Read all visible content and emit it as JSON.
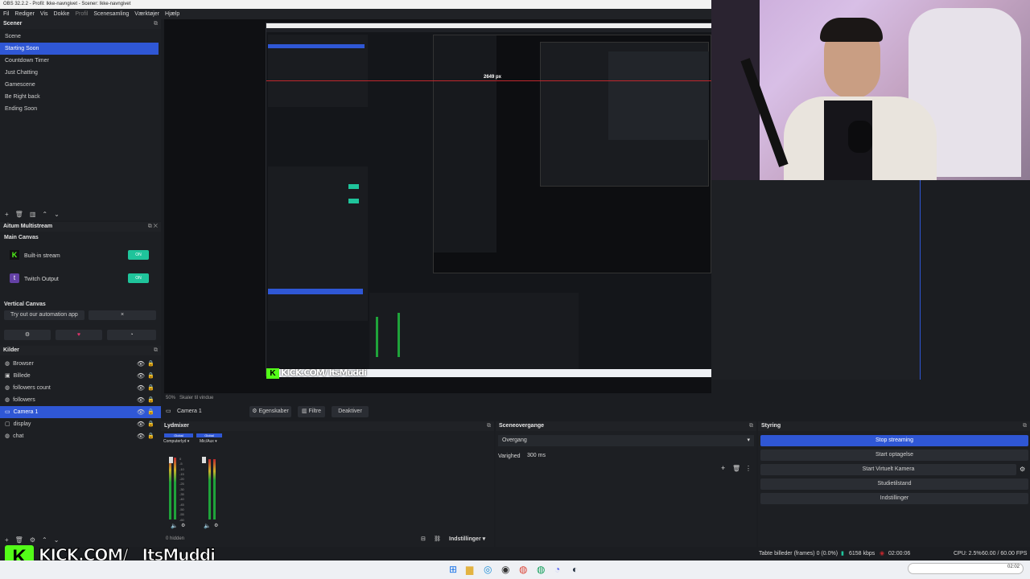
{
  "window": {
    "title": "OBS 32.2.2 - Profil: Ikke-navngivet - Scener: Ikke-navngivet"
  },
  "menu": [
    "Fil",
    "Rediger",
    "Vis",
    "Dokke",
    "Profil",
    "Scenesamling",
    "Værktøjer",
    "Hjælp"
  ],
  "scenes": {
    "header": "Scener",
    "items": [
      "Scene",
      "Starting Soon",
      "Countdown Timer",
      "Just Chatting",
      "Gamescene",
      "Be Right back",
      "Ending Soon"
    ],
    "selected": "Starting Soon"
  },
  "multistream": {
    "header": "Aitum Multistream",
    "main_canvas": "Main Canvas",
    "outputs": [
      {
        "label": "Built-in stream",
        "icon": "kick-icon"
      },
      {
        "label": "Twitch Output",
        "icon": "twitch-icon"
      }
    ],
    "vertical_canvas": "Vertical Canvas",
    "automation": "Try out our automation app",
    "close": "×"
  },
  "sources": {
    "header": "Kilder",
    "items": [
      "Browser",
      "Billede",
      "followers count",
      "followers",
      "Camera 1",
      "display",
      "chat"
    ],
    "selected": "Camera 1",
    "hidden_count": "0 hidden"
  },
  "source_bar": {
    "name": "Camera 1",
    "properties": "Egenskaber",
    "filters": "Filtre",
    "deactivate": "Deaktiver"
  },
  "preview_status": {
    "zoom": "50%",
    "scale_hint": "Skaler til vindue"
  },
  "audio": {
    "header": "Lydmixer",
    "channels": [
      {
        "tag": "Global",
        "name": "Computerlyd"
      },
      {
        "tag": "Global",
        "name": "Mic/Aux"
      }
    ],
    "scale": [
      "0",
      "-5",
      "-10",
      "-15",
      "-20",
      "-25",
      "-30",
      "-35",
      "-40",
      "-45",
      "-50",
      "-55",
      "-60"
    ],
    "settings": "Indstillinger"
  },
  "transitions": {
    "header": "Sceneovergange",
    "selected": "Overgang",
    "duration_label": "Varighed",
    "duration": "300 ms"
  },
  "controls": {
    "header": "Styring",
    "buttons": [
      "Stop streaming",
      "Start optagelse",
      "Start Virtuelt Kamera",
      "Studietilstand",
      "Indstillinger"
    ]
  },
  "status": {
    "frames": "Tabte billeder (frames) 0 (0.0%)",
    "kbps": "6158 kbps",
    "time": "02:00:06",
    "cpu": "CPU: 2.5%",
    "fps": "60.00 / 60.00 FPS"
  },
  "overlay": {
    "kick_text": "KICK.COM/",
    "kick_user": "ItsMuddi",
    "measure": "2649 px",
    "clock": "02:02"
  },
  "colors": {
    "accent": "#2f57d5",
    "kick": "#53fc18",
    "toggle": "#1fc49b"
  }
}
